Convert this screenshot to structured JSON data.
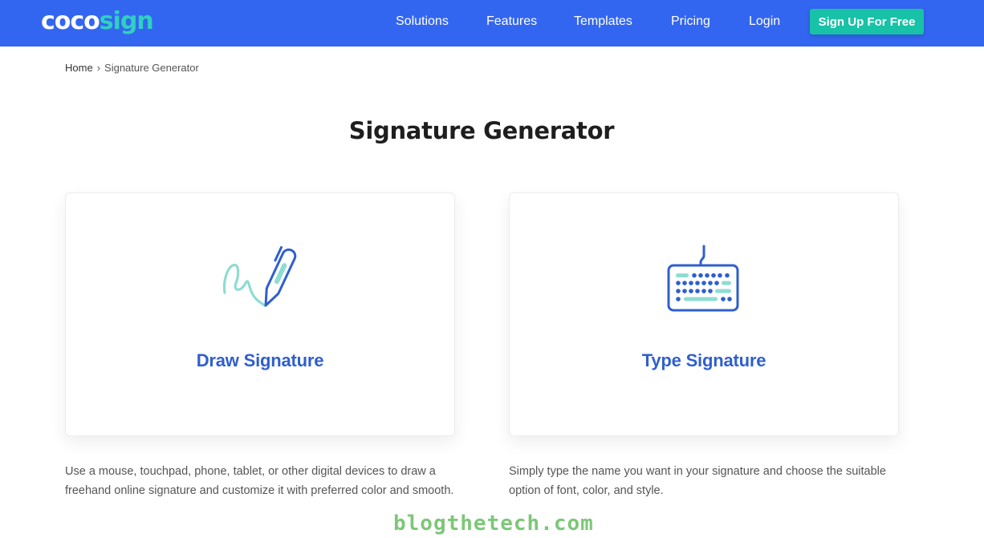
{
  "brand": {
    "part1": "coco",
    "part2": "sign",
    "color_primary": "#3366f0",
    "color_accent": "#2fd0c0"
  },
  "nav": {
    "links": [
      {
        "label": "Solutions"
      },
      {
        "label": "Features"
      },
      {
        "label": "Templates"
      },
      {
        "label": "Pricing"
      },
      {
        "label": "Login"
      }
    ],
    "cta": "Sign Up For Free",
    "cta_color": "#17c2a7"
  },
  "breadcrumb": {
    "home": "Home",
    "separator": "›",
    "current": "Signature Generator"
  },
  "page_title": "Signature Generator",
  "cards": {
    "draw": {
      "label": "Draw Signature",
      "icon": "pen-signature-icon"
    },
    "type": {
      "label": "Type Signature",
      "icon": "keyboard-icon"
    }
  },
  "descriptions": {
    "draw": "Use a mouse, touchpad, phone, tablet, or other digital devices to draw a freehand online signature and customize it with preferred color and smooth.",
    "type": "Simply type the name you want in your signature and choose the suitable option of font, color, and style."
  },
  "watermark": "blogthetech.com"
}
